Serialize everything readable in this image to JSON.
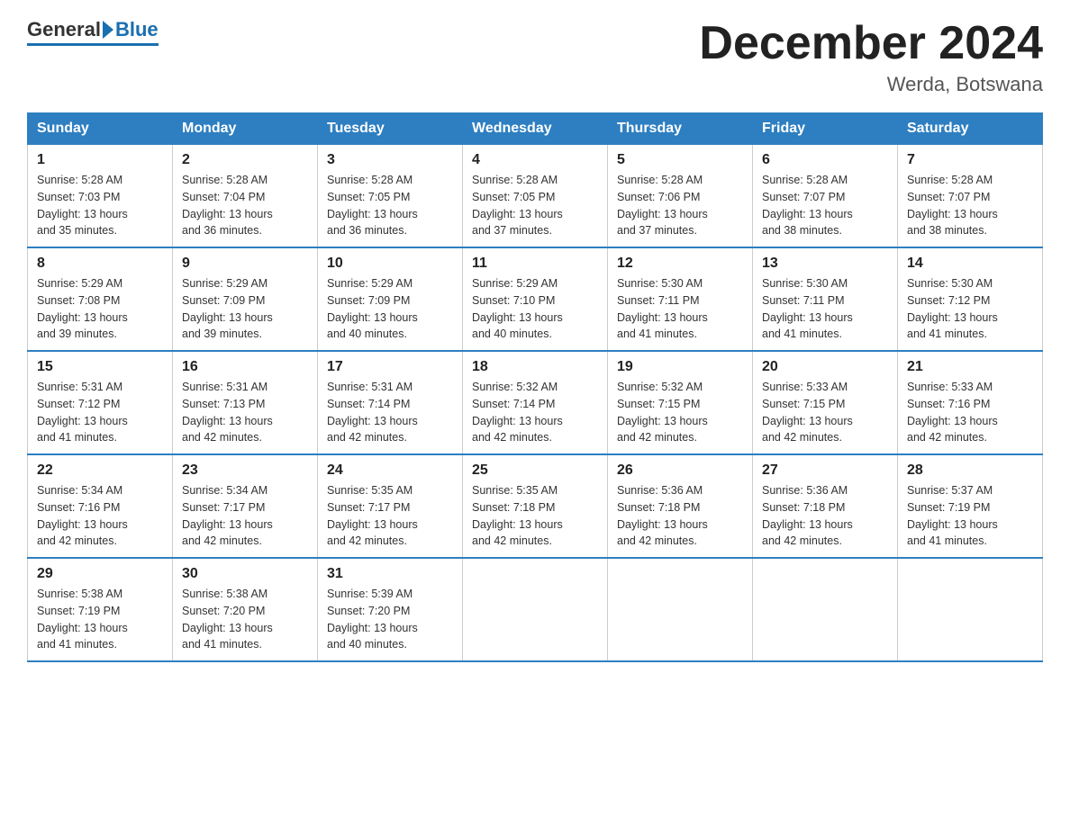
{
  "logo": {
    "general": "General",
    "blue": "Blue"
  },
  "title": "December 2024",
  "location": "Werda, Botswana",
  "days_of_week": [
    "Sunday",
    "Monday",
    "Tuesday",
    "Wednesday",
    "Thursday",
    "Friday",
    "Saturday"
  ],
  "weeks": [
    [
      {
        "day": "1",
        "sunrise": "5:28 AM",
        "sunset": "7:03 PM",
        "daylight": "13 hours and 35 minutes."
      },
      {
        "day": "2",
        "sunrise": "5:28 AM",
        "sunset": "7:04 PM",
        "daylight": "13 hours and 36 minutes."
      },
      {
        "day": "3",
        "sunrise": "5:28 AM",
        "sunset": "7:05 PM",
        "daylight": "13 hours and 36 minutes."
      },
      {
        "day": "4",
        "sunrise": "5:28 AM",
        "sunset": "7:05 PM",
        "daylight": "13 hours and 37 minutes."
      },
      {
        "day": "5",
        "sunrise": "5:28 AM",
        "sunset": "7:06 PM",
        "daylight": "13 hours and 37 minutes."
      },
      {
        "day": "6",
        "sunrise": "5:28 AM",
        "sunset": "7:07 PM",
        "daylight": "13 hours and 38 minutes."
      },
      {
        "day": "7",
        "sunrise": "5:28 AM",
        "sunset": "7:07 PM",
        "daylight": "13 hours and 38 minutes."
      }
    ],
    [
      {
        "day": "8",
        "sunrise": "5:29 AM",
        "sunset": "7:08 PM",
        "daylight": "13 hours and 39 minutes."
      },
      {
        "day": "9",
        "sunrise": "5:29 AM",
        "sunset": "7:09 PM",
        "daylight": "13 hours and 39 minutes."
      },
      {
        "day": "10",
        "sunrise": "5:29 AM",
        "sunset": "7:09 PM",
        "daylight": "13 hours and 40 minutes."
      },
      {
        "day": "11",
        "sunrise": "5:29 AM",
        "sunset": "7:10 PM",
        "daylight": "13 hours and 40 minutes."
      },
      {
        "day": "12",
        "sunrise": "5:30 AM",
        "sunset": "7:11 PM",
        "daylight": "13 hours and 41 minutes."
      },
      {
        "day": "13",
        "sunrise": "5:30 AM",
        "sunset": "7:11 PM",
        "daylight": "13 hours and 41 minutes."
      },
      {
        "day": "14",
        "sunrise": "5:30 AM",
        "sunset": "7:12 PM",
        "daylight": "13 hours and 41 minutes."
      }
    ],
    [
      {
        "day": "15",
        "sunrise": "5:31 AM",
        "sunset": "7:12 PM",
        "daylight": "13 hours and 41 minutes."
      },
      {
        "day": "16",
        "sunrise": "5:31 AM",
        "sunset": "7:13 PM",
        "daylight": "13 hours and 42 minutes."
      },
      {
        "day": "17",
        "sunrise": "5:31 AM",
        "sunset": "7:14 PM",
        "daylight": "13 hours and 42 minutes."
      },
      {
        "day": "18",
        "sunrise": "5:32 AM",
        "sunset": "7:14 PM",
        "daylight": "13 hours and 42 minutes."
      },
      {
        "day": "19",
        "sunrise": "5:32 AM",
        "sunset": "7:15 PM",
        "daylight": "13 hours and 42 minutes."
      },
      {
        "day": "20",
        "sunrise": "5:33 AM",
        "sunset": "7:15 PM",
        "daylight": "13 hours and 42 minutes."
      },
      {
        "day": "21",
        "sunrise": "5:33 AM",
        "sunset": "7:16 PM",
        "daylight": "13 hours and 42 minutes."
      }
    ],
    [
      {
        "day": "22",
        "sunrise": "5:34 AM",
        "sunset": "7:16 PM",
        "daylight": "13 hours and 42 minutes."
      },
      {
        "day": "23",
        "sunrise": "5:34 AM",
        "sunset": "7:17 PM",
        "daylight": "13 hours and 42 minutes."
      },
      {
        "day": "24",
        "sunrise": "5:35 AM",
        "sunset": "7:17 PM",
        "daylight": "13 hours and 42 minutes."
      },
      {
        "day": "25",
        "sunrise": "5:35 AM",
        "sunset": "7:18 PM",
        "daylight": "13 hours and 42 minutes."
      },
      {
        "day": "26",
        "sunrise": "5:36 AM",
        "sunset": "7:18 PM",
        "daylight": "13 hours and 42 minutes."
      },
      {
        "day": "27",
        "sunrise": "5:36 AM",
        "sunset": "7:18 PM",
        "daylight": "13 hours and 42 minutes."
      },
      {
        "day": "28",
        "sunrise": "5:37 AM",
        "sunset": "7:19 PM",
        "daylight": "13 hours and 41 minutes."
      }
    ],
    [
      {
        "day": "29",
        "sunrise": "5:38 AM",
        "sunset": "7:19 PM",
        "daylight": "13 hours and 41 minutes."
      },
      {
        "day": "30",
        "sunrise": "5:38 AM",
        "sunset": "7:20 PM",
        "daylight": "13 hours and 41 minutes."
      },
      {
        "day": "31",
        "sunrise": "5:39 AM",
        "sunset": "7:20 PM",
        "daylight": "13 hours and 40 minutes."
      },
      null,
      null,
      null,
      null
    ]
  ],
  "labels": {
    "sunrise": "Sunrise:",
    "sunset": "Sunset:",
    "daylight": "Daylight:"
  }
}
